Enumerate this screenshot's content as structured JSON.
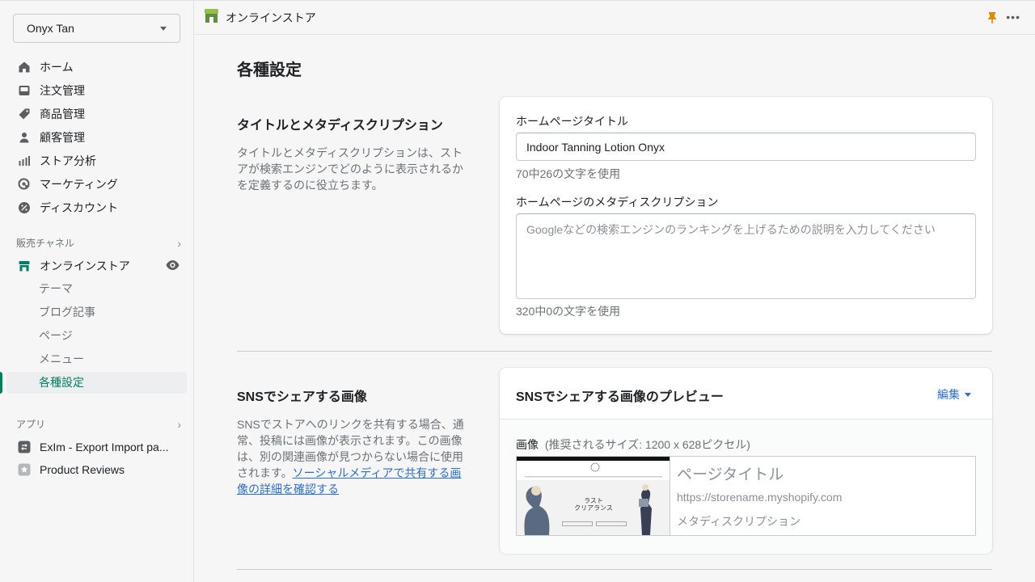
{
  "sidebar": {
    "store_name": "Onyx Tan",
    "nav": [
      {
        "label": "ホーム",
        "icon": "home-icon"
      },
      {
        "label": "注文管理",
        "icon": "inbox-icon"
      },
      {
        "label": "商品管理",
        "icon": "tag-icon"
      },
      {
        "label": "顧客管理",
        "icon": "person-icon"
      },
      {
        "label": "ストア分析",
        "icon": "bar-chart-icon"
      },
      {
        "label": "マーケティング",
        "icon": "target-icon"
      },
      {
        "label": "ディスカウント",
        "icon": "discount-icon"
      }
    ],
    "sales_channels": {
      "header": "販売チャネル",
      "online_store": "オンラインストア",
      "sub_items": [
        "テーマ",
        "ブログ記事",
        "ページ",
        "メニュー",
        "各種設定"
      ],
      "active": "各種設定"
    },
    "apps": {
      "header": "アプリ",
      "items": [
        "ExIm - Export Import pa...",
        "Product Reviews"
      ]
    }
  },
  "topbar": {
    "title": "オンラインストア"
  },
  "main": {
    "page_title": "各種設定",
    "seo": {
      "title": "タイトルとメタディスクリプション",
      "description": "タイトルとメタディスクリプションは、ストアが検索エンジンでどのように表示されるかを定義するのに役立ちます。",
      "home_title_label": "ホームページタイトル",
      "home_title_value": "Indoor Tanning Lotion Onyx",
      "home_title_count": "70中26の文字を使用",
      "meta_label": "ホームページのメタディスクリプション",
      "meta_placeholder": "Googleなどの検索エンジンのランキングを上げるための説明を入力してください",
      "meta_count": "320中0の文字を使用"
    },
    "social": {
      "title": "SNSでシェアする画像",
      "description": "SNSでストアへのリンクを共有する場合、通常、投稿には画像が表示されます。この画像は、別の関連画像が見つからない場合に使用されます。",
      "link_text": "ソーシャルメディアで共有する画像の詳細を確認する",
      "card_title": "SNSでシェアする画像のプレビュー",
      "edit_label": "編集",
      "image_label": "画像",
      "image_hint": "(推奨されるサイズ: 1200 x 628ピクセル)",
      "preview_title": "ページタイトル",
      "preview_url": "https://storename.myshopify.com",
      "preview_meta": "メタディスクリプション",
      "preview_image_heading": "ラスト\nクリアランス"
    }
  },
  "colors": {
    "accent_green": "#008060",
    "link_blue": "#2c6ecb",
    "pin_orange": "#e08b00"
  }
}
